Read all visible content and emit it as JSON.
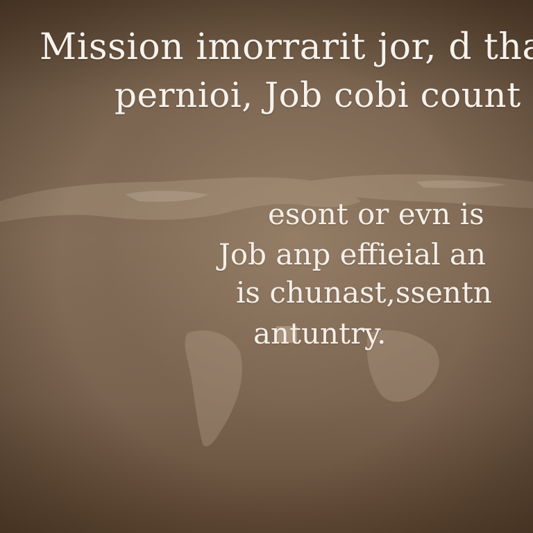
{
  "headline": {
    "line1": "Mission imorrarit jor, d tha",
    "line2": "pernioi, Job cobi count"
  },
  "paragraph": {
    "line1": "esont or evn is",
    "line2": "Job anp effieial an",
    "line3": "is chunast,ssentn",
    "line4": "antuntry."
  },
  "colors": {
    "background": "#7a6450",
    "text": "#f7f2ec"
  }
}
